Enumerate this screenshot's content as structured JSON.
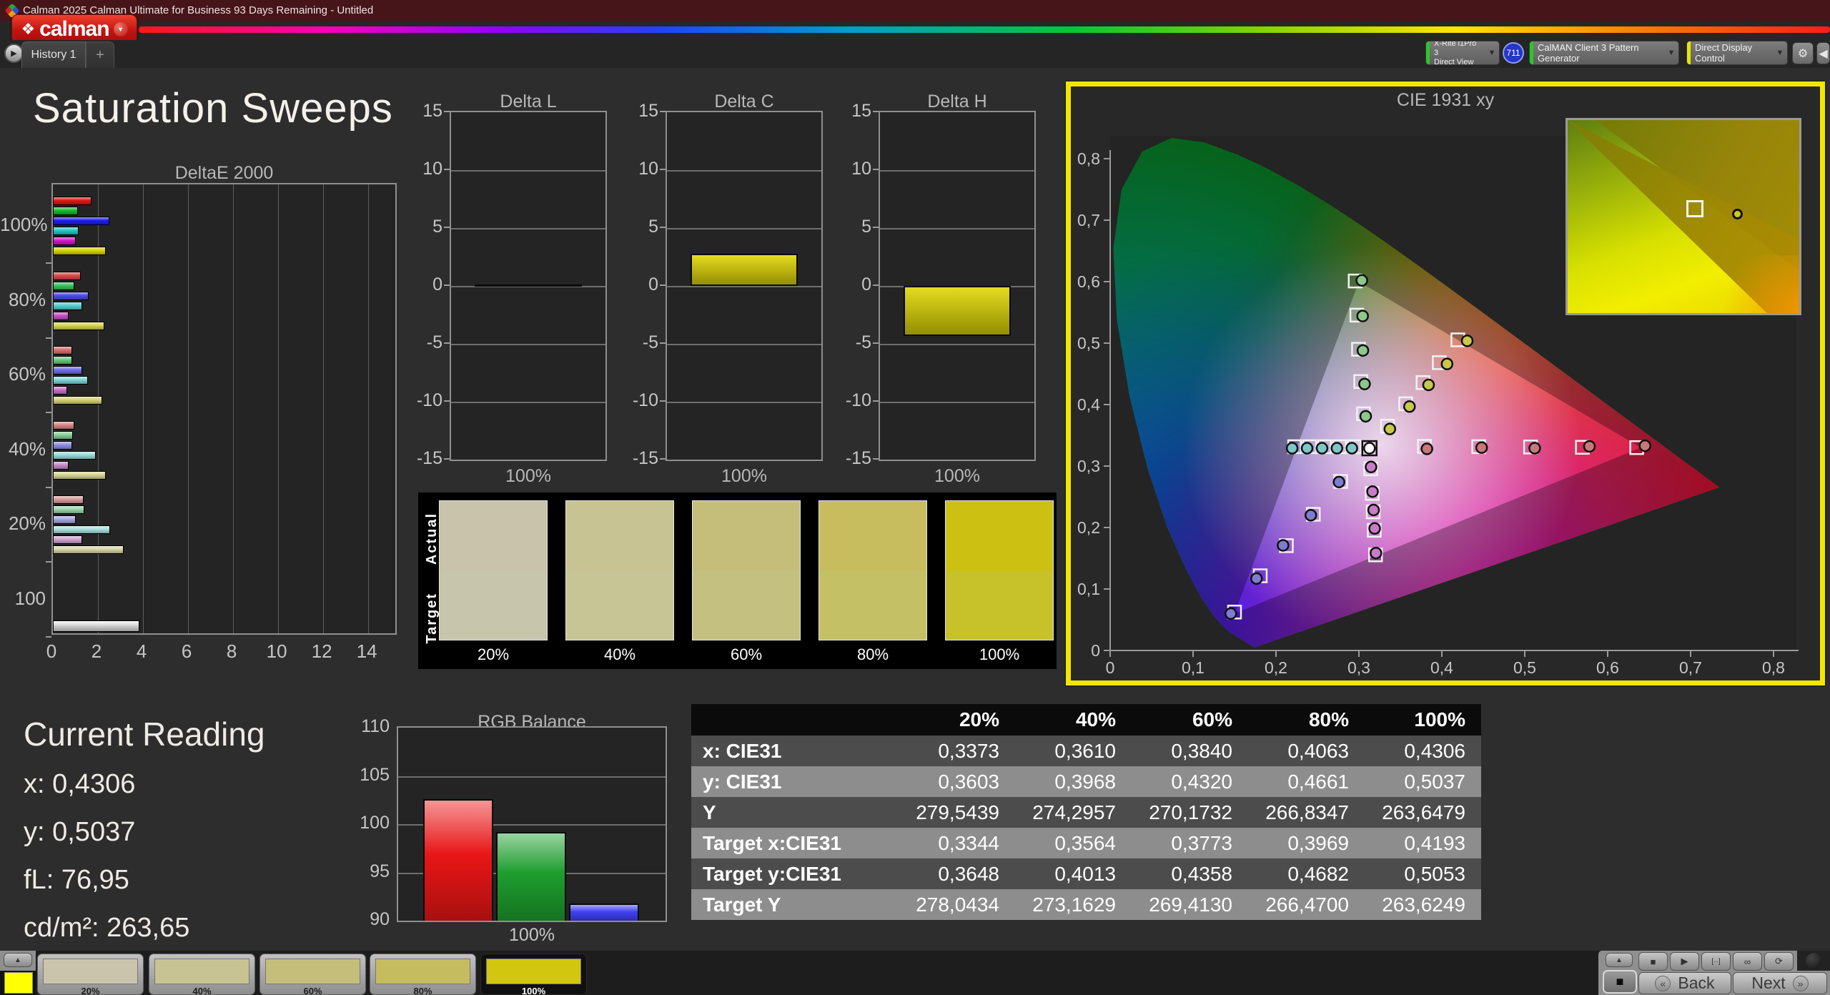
{
  "titlebar": {
    "title": "Calman 2025 Calman Ultimate for Business 93 Days Remaining  - Untitled"
  },
  "logo": {
    "word": "calman"
  },
  "tabs": {
    "history": "History 1",
    "add": "+"
  },
  "toolbar": {
    "meter": {
      "line1": "X-Rite i1Pro 3",
      "line2": "Direct View",
      "stripe": "#28c828",
      "badge": "711"
    },
    "generator": {
      "label": "CalMAN Client 3 Pattern Generator",
      "stripe": "#28c828"
    },
    "display_control": {
      "label": "Direct Display Control",
      "stripe": "#e8e400"
    }
  },
  "page": {
    "title": "Saturation Sweeps"
  },
  "current_reading": {
    "title": "Current Reading",
    "lines": [
      "x: 0,4306",
      "y: 0,5037",
      "fL: 76,95",
      "cd/m²: 263,65"
    ]
  },
  "chart_data": {
    "deltae": {
      "type": "bar",
      "title": "DeltaE 2000",
      "xlim": [
        0,
        15.2
      ],
      "xticks": [
        0,
        2,
        4,
        6,
        8,
        10,
        12,
        14
      ],
      "groups": [
        {
          "label": "100%",
          "values": [
            1.7,
            1.1,
            2.5,
            1.15,
            1.0,
            2.35
          ],
          "colors": [
            "#e01616",
            "#14bc2c",
            "#1d1df2",
            "#1fc8c8",
            "#d016d0",
            "#d6d400"
          ]
        },
        {
          "label": "80%",
          "values": [
            1.25,
            0.95,
            1.6,
            1.3,
            0.7,
            2.3
          ],
          "colors": [
            "#db4848",
            "#3cc25c",
            "#4b4be8",
            "#54cfcf",
            "#c84ec8",
            "#d6d452"
          ]
        },
        {
          "label": "60%",
          "values": [
            0.85,
            0.85,
            1.3,
            1.55,
            0.65,
            2.2
          ],
          "colors": [
            "#d96e6e",
            "#64ca80",
            "#6e6ee6",
            "#7cd6d6",
            "#c870c8",
            "#d4d276"
          ]
        },
        {
          "label": "40%",
          "values": [
            0.95,
            0.9,
            0.85,
            1.9,
            0.7,
            2.35
          ],
          "colors": [
            "#d98585",
            "#82d098",
            "#8d8de4",
            "#97dcdc",
            "#cc8acc",
            "#d6d492"
          ]
        },
        {
          "label": "20%",
          "values": [
            1.35,
            1.4,
            1.0,
            2.55,
            1.3,
            3.15
          ],
          "colors": [
            "#d99b9b",
            "#9cd6ac",
            "#a7a7e6",
            "#abe0e0",
            "#d0a2d0",
            "#d8d6a6"
          ]
        },
        {
          "label": "100",
          "values": [
            3.85
          ],
          "colors": [
            "#ffffff"
          ]
        }
      ]
    },
    "delta_l": {
      "type": "bar",
      "title": "Delta L",
      "value": 0.0,
      "ylim": [
        -15,
        15
      ],
      "yticks": [
        15,
        10,
        5,
        0,
        -5,
        -10,
        -15
      ],
      "xlabel": "100%"
    },
    "delta_c": {
      "type": "bar",
      "title": "Delta C",
      "value": 2.8,
      "ylim": [
        -15,
        15
      ],
      "yticks": [
        15,
        10,
        5,
        0,
        -5,
        -10,
        -15
      ],
      "xlabel": "100%"
    },
    "delta_h": {
      "type": "bar",
      "title": "Delta H",
      "value": -4.3,
      "ylim": [
        -15,
        15
      ],
      "yticks": [
        15,
        10,
        5,
        0,
        -5,
        -10,
        -15
      ],
      "xlabel": "100%"
    },
    "rgb_balance": {
      "type": "bar",
      "title": "RGB Balance",
      "ylim": [
        90,
        110
      ],
      "yticks": [
        110,
        105,
        100,
        95,
        90
      ],
      "xlabel": "100%",
      "bars": [
        {
          "name": "red",
          "value": 102.6,
          "color": "#e81616"
        },
        {
          "name": "green",
          "value": 99.2,
          "color": "#1e9e2e"
        },
        {
          "name": "blue",
          "value": 91.8,
          "color": "#4040f0"
        }
      ]
    },
    "cie": {
      "type": "scatter",
      "title": "CIE 1931 xy",
      "xticks": [
        "0",
        "0,1",
        "0,2",
        "0,3",
        "0,4",
        "0,5",
        "0,6",
        "0,7",
        "0,8"
      ],
      "yticks": [
        "0",
        "0,1",
        "0,2",
        "0,3",
        "0,4",
        "0,5",
        "0,6",
        "0,7",
        "0,8"
      ],
      "gamut_triangle": {
        "red": [
          0.64,
          0.33
        ],
        "green": [
          0.3,
          0.6
        ],
        "blue": [
          0.15,
          0.06
        ]
      },
      "white_point": [
        0.3127,
        0.329
      ],
      "sweeps": {
        "yellow": {
          "dot": "#c8c84a",
          "targets": [
            [
              0.3344,
              0.3648
            ],
            [
              0.3564,
              0.4013
            ],
            [
              0.3773,
              0.4358
            ],
            [
              0.3969,
              0.4682
            ],
            [
              0.4193,
              0.5053
            ]
          ],
          "measured": [
            [
              0.3373,
              0.3603
            ],
            [
              0.361,
              0.3968
            ],
            [
              0.384,
              0.432
            ],
            [
              0.4063,
              0.4661
            ],
            [
              0.4306,
              0.5037
            ]
          ]
        },
        "red": {
          "dot": "#c87878",
          "targets": [
            [
              0.379,
              0.332
            ],
            [
              0.4445,
              0.3315
            ],
            [
              0.507,
              0.331
            ],
            [
              0.5695,
              0.3305
            ],
            [
              0.635,
              0.33
            ]
          ],
          "measured": [
            [
              0.382,
              0.328
            ],
            [
              0.448,
              0.33
            ],
            [
              0.512,
              0.329
            ],
            [
              0.578,
              0.332
            ],
            [
              0.645,
              0.333
            ]
          ]
        },
        "green": {
          "dot": "#8cc88c",
          "targets": [
            [
              0.2955,
              0.601
            ],
            [
              0.2975,
              0.5455
            ],
            [
              0.2995,
              0.49
            ],
            [
              0.3022,
              0.4375
            ],
            [
              0.3055,
              0.385
            ]
          ],
          "measured": [
            [
              0.3035,
              0.602
            ],
            [
              0.3045,
              0.544
            ],
            [
              0.3048,
              0.488
            ],
            [
              0.3068,
              0.4335
            ],
            [
              0.3082,
              0.381
            ]
          ]
        },
        "cyan": {
          "dot": "#7cc8c8",
          "targets": [
            [
              0.2225,
              0.3315
            ],
            [
              0.2405,
              0.3315
            ],
            [
              0.2585,
              0.3315
            ],
            [
              0.2765,
              0.3315
            ],
            [
              0.2945,
              0.3315
            ]
          ],
          "measured": [
            [
              0.2195,
              0.329
            ],
            [
              0.2375,
              0.329
            ],
            [
              0.2555,
              0.329
            ],
            [
              0.2735,
              0.329
            ],
            [
              0.2915,
              0.329
            ]
          ]
        },
        "magenta": {
          "dot": "#c87cc8",
          "targets": [
            [
              0.32,
              0.1555
            ],
            [
              0.3185,
              0.1955
            ],
            [
              0.3172,
              0.2255
            ],
            [
              0.316,
              0.2555
            ],
            [
              0.3142,
              0.2955
            ]
          ],
          "measured": [
            [
              0.3205,
              0.1585
            ],
            [
              0.319,
              0.1985
            ],
            [
              0.3177,
              0.2285
            ],
            [
              0.3164,
              0.2585
            ],
            [
              0.3146,
              0.2985
            ]
          ]
        },
        "blue": {
          "dot": "#7c7cd0",
          "targets": [
            [
              0.15,
              0.0625
            ],
            [
              0.181,
              0.1215
            ],
            [
              0.2125,
              0.1705
            ],
            [
              0.245,
              0.2215
            ],
            [
              0.278,
              0.275
            ]
          ],
          "measured": [
            [
              0.1455,
              0.06
            ],
            [
              0.1765,
              0.117
            ],
            [
              0.2085,
              0.171
            ],
            [
              0.242,
              0.22
            ],
            [
              0.276,
              0.274
            ]
          ]
        }
      },
      "inset": {
        "square": [
          0.54,
          0.45
        ],
        "circle": [
          0.72,
          0.48
        ]
      }
    }
  },
  "swatch_compare": {
    "row_labels": [
      "Actual",
      "Target"
    ],
    "columns": [
      "20%",
      "40%",
      "60%",
      "80%",
      "100%"
    ],
    "actual": [
      "#c8c3aa",
      "#c8c392",
      "#c5be7b",
      "#c7bd5e",
      "#ccc013"
    ],
    "target": [
      "#c7c5ab",
      "#c7c595",
      "#c4c180",
      "#c4c065",
      "#c7c12a"
    ]
  },
  "table": {
    "columns": [
      "20%",
      "40%",
      "60%",
      "80%",
      "100%"
    ],
    "rows": [
      {
        "label": "x: CIE31",
        "values": [
          "0,3373",
          "0,3610",
          "0,3840",
          "0,4063",
          "0,4306"
        ]
      },
      {
        "label": "y: CIE31",
        "values": [
          "0,3603",
          "0,3968",
          "0,4320",
          "0,4661",
          "0,5037"
        ]
      },
      {
        "label": "Y",
        "values": [
          "279,5439",
          "274,2957",
          "270,1732",
          "266,8347",
          "263,6479"
        ]
      },
      {
        "label": "Target x:CIE31",
        "values": [
          "0,3344",
          "0,3564",
          "0,3773",
          "0,3969",
          "0,4193"
        ]
      },
      {
        "label": "Target y:CIE31",
        "values": [
          "0,3648",
          "0,4013",
          "0,4358",
          "0,4682",
          "0,5053"
        ]
      },
      {
        "label": "Target Y",
        "values": [
          "278,0434",
          "273,1629",
          "269,4130",
          "266,4700",
          "263,6249"
        ]
      }
    ]
  },
  "bottom": {
    "patch_color": "#ffff00",
    "swatch_buttons": [
      {
        "label": "20%",
        "color": "#c9c4ab",
        "selected": false
      },
      {
        "label": "40%",
        "color": "#c8c392",
        "selected": false
      },
      {
        "label": "60%",
        "color": "#c5be7b",
        "selected": false
      },
      {
        "label": "80%",
        "color": "#c5bc5f",
        "selected": false
      },
      {
        "label": "100%",
        "color": "#d3c60e",
        "selected": true
      }
    ],
    "transport": [
      {
        "name": "stop",
        "glyph": "■"
      },
      {
        "name": "play",
        "glyph": "▶"
      },
      {
        "name": "pattern",
        "glyph": "[··]"
      },
      {
        "name": "loop",
        "glyph": "∞"
      },
      {
        "name": "refresh",
        "glyph": "⟳"
      }
    ],
    "back_label": "Back",
    "next_label": "Next"
  }
}
